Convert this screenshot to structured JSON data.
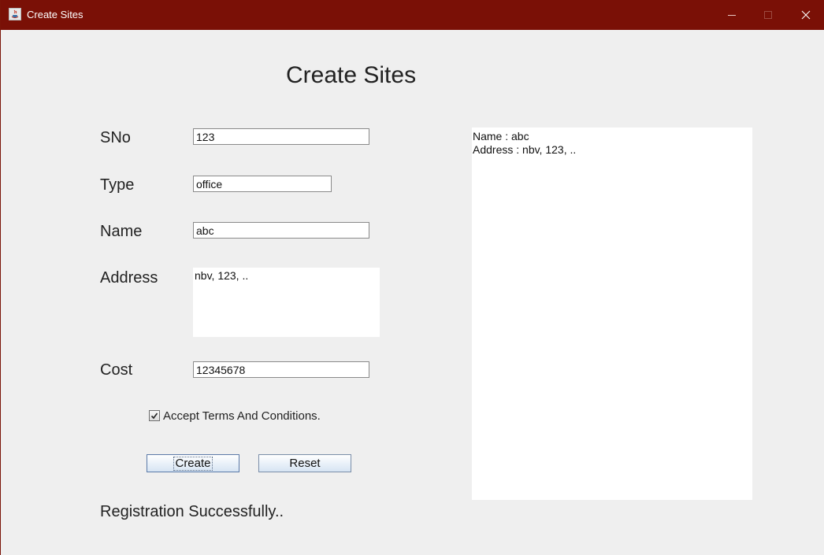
{
  "window": {
    "title": "Create Sites",
    "colors": {
      "titlebar": "#7a1006",
      "background": "#efefef"
    },
    "icons": {
      "app": "java-icon",
      "minimize": "minimize-icon",
      "maximize": "maximize-icon",
      "close": "close-icon"
    }
  },
  "form": {
    "heading": "Create Sites",
    "sno": {
      "label": "SNo",
      "value": "123"
    },
    "type": {
      "label": "Type",
      "value": "office"
    },
    "name": {
      "label": "Name",
      "value": "abc"
    },
    "address": {
      "label": "Address",
      "value": "nbv, 123, .."
    },
    "cost": {
      "label": "Cost",
      "value": "12345678"
    },
    "terms": {
      "label": "Accept Terms And Conditions.",
      "checked": true
    },
    "buttons": {
      "create": "Create",
      "reset": "Reset"
    },
    "status": "Registration Successfully.."
  },
  "output": {
    "lines": [
      "Name : abc",
      "Address : nbv, 123, .."
    ]
  }
}
